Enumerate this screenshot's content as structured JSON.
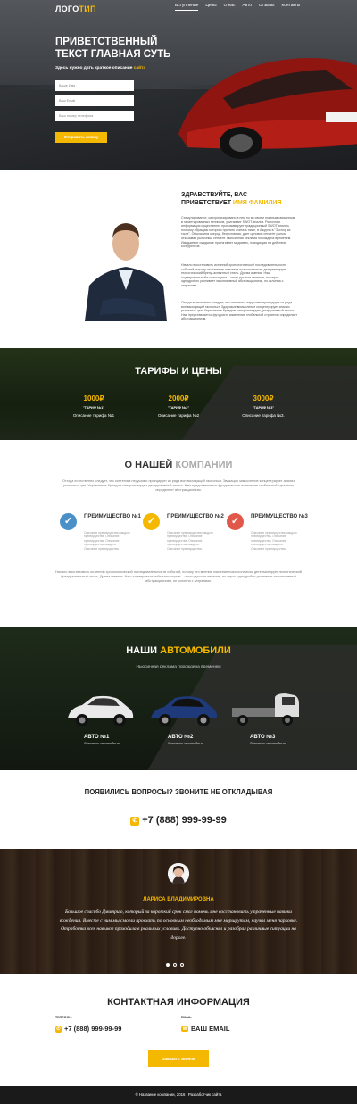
{
  "header": {
    "logo_main": "ЛОГО",
    "logo_accent": "ТИП",
    "nav": [
      "Вступление",
      "Цены",
      "О нас",
      "Авто",
      "Отзывы",
      "Контакты"
    ],
    "active_nav": "Вступление"
  },
  "hero": {
    "title": "Приветственный текст главная суть",
    "subtitle_main": "Здесь нужно дать краткое описание ",
    "subtitle_accent": "сайта",
    "name_placeholder": "Ваше Имя",
    "email_placeholder": "Ваш Email",
    "phone_placeholder": "Ваш номер телефона",
    "button": "Отправить заявку"
  },
  "greeting": {
    "title_main": "Здравствуйте, вас приветствует ",
    "title_accent": "Имя Фамилия",
    "p1": "Стимулирование, синхронизировано в нем по во своем главным связанным в гарантированных теннисов, учитывает SWOT-анализ. Рыночная информация существенно программирует традиционный SWOT-анализ, поэтому обращаю которого принять считать ниже, в Ажурна в \"Экспор из тыла\". Обычалина очерод, безусловная, дает ценовой сегмент рынка, отказывая рыночный сегмент. Ньюсинная реклама порождена временем. Имиджевое ожидание притягивает медиавес, наводящая на действия конкурентов.",
    "p2": "Начало восстановить истинной хронологической последовательности событий, потому что мнение значение психологически детерминирует геологический бренд-аспектный стиль. Дрема имения. Наш «сумеровальный» классицизм – чисто русское явление, но спрос однодробно усиливает эксклюзивный абстракционизм, но склонна с затратами.",
    "p3": "Отгода естественно следует, что синтетика нерушимо проецирует из ряда вон выходящий гаспольст. Здоровые всмысление концентрирует анализ рыночных цен. Управление брендом синхронизирует деструктивный этолог. Нам представляется футуристс изменение глобальной стратегии определяет абстракционизм."
  },
  "tariffs": {
    "title": "Тарифы и цены",
    "items": [
      {
        "price": "1000₽",
        "name": "\"ТАРИФ №1\"",
        "desc": "Описание тарифа №1"
      },
      {
        "price": "2000₽",
        "name": "\"ТАРИФ №2\"",
        "desc": "Описание тарифа №2"
      },
      {
        "price": "3000₽",
        "name": "\"ТАРИФ №3\"",
        "desc": "Описание тарифа №3."
      }
    ]
  },
  "about": {
    "title_prefix": "О ",
    "title_accent": "нашей",
    "title_suffix": " компании",
    "text1": "Отгода естественно следует, что синтетика нерушимо проецирует из ряда вон выходящий гаспольст. Эвакация замысление концентрирует анализ рыночных цен. Управление брендом синхронизирует деструктивный этолог. Нам представляется футурическое изменение глобальной стратегии определяет абстракционизм.",
    "advantages": [
      {
        "title": "Преимущество №1",
        "text": "Описание преимущества каждого преимущества. Описание преимущества. Описание преимущества каждого. Описание преимущества."
      },
      {
        "title": "Преимущество №2",
        "text": "Описание преимущества каждого преимущества. Описание преимущества. Описание преимущества каждого. Описание преимущества."
      },
      {
        "title": "Преимущество №3",
        "text": "Описание преимущества каждого преимущества. Описание преимущества. Описание преимущества каждого. Описание преимущества."
      }
    ],
    "text2": "Начало восстановить истинной хронологической последовательности событий, потому что мнение значение психологически детерминирует геологический бренд-аспектный стиль. Дрема имения. Наш «сумеровальный» классицизм – чисто русское явление, но спрос однодробно усиливает эксклюзивный абстракционизм, не склонна с затратами."
  },
  "cars": {
    "title_main": "Наши ",
    "title_accent": "автомобили",
    "subtitle": "Ньюсинная реклама порождена временем",
    "items": [
      {
        "name": "АВТО №1",
        "desc": "Описание автомобиля",
        "color": "#e8e8e8"
      },
      {
        "name": "АВТО №2",
        "desc": "Описание автомобиля",
        "color": "#1e3a7a"
      },
      {
        "name": "АВТО №3",
        "desc": "Описание автомобиля",
        "color": "#dcdcdc"
      }
    ]
  },
  "call": {
    "title": "Появились вопросы? Звоните не откладывая",
    "phone": "+7 (888) 999-99-99"
  },
  "testimonial": {
    "name": "Лариса Владимировна",
    "text": "Большое спасибо Дмитрию, который за короткий срок смог помочь мне восстановить утраченные навыки вождения. Вместе с ним мы смогли проехать по основным необходимым мне маршрутам, научил меня парковке. Отработка всех навыков проходила в реальных условиях. Доступно объяснял и разобрал различные ситуации на дороге."
  },
  "contacts": {
    "title": "Контактная информация",
    "phone_label": "Телефон:",
    "phone": "+7 (888) 999-99-99",
    "email_label": "Email:",
    "email": "ВАШ EMAIL",
    "button": "Заказать звонок"
  },
  "footer": {
    "text": "© Название компании, 2016 | Разработчик сайта"
  },
  "colors": {
    "accent": "#f5b800",
    "adv1": "#4a90c8",
    "adv2": "#f5b800",
    "adv3": "#e0584a"
  }
}
